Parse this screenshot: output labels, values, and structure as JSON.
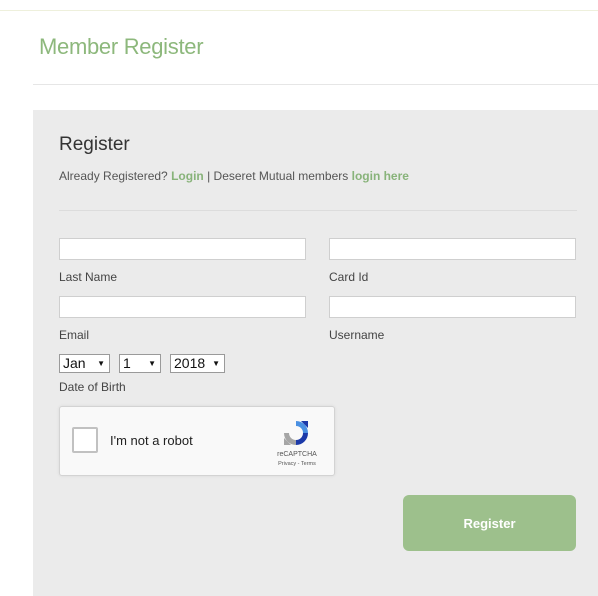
{
  "header": {
    "title": "Member Register"
  },
  "form": {
    "heading": "Register",
    "already_text": "Already Registered?",
    "login_link": "Login",
    "separator": "|",
    "deseret_text": "Deseret Mutual members",
    "login_here_link": "login here",
    "fields": {
      "last_name": {
        "label": "Last Name",
        "value": ""
      },
      "card_id": {
        "label": "Card Id",
        "value": ""
      },
      "email": {
        "label": "Email",
        "value": ""
      },
      "username": {
        "label": "Username",
        "value": ""
      }
    },
    "dob": {
      "month": "Jan",
      "day": "1",
      "year": "2018",
      "label": "Date of Birth"
    },
    "recaptcha": {
      "label": "I'm not a robot",
      "brand": "reCAPTCHA",
      "terms": "Privacy - Terms"
    },
    "submit_label": "Register"
  },
  "colors": {
    "accent_green": "#8db87c",
    "link_green": "#88b37a",
    "button_green": "#9dc08c",
    "panel_bg": "#ebebeb"
  }
}
